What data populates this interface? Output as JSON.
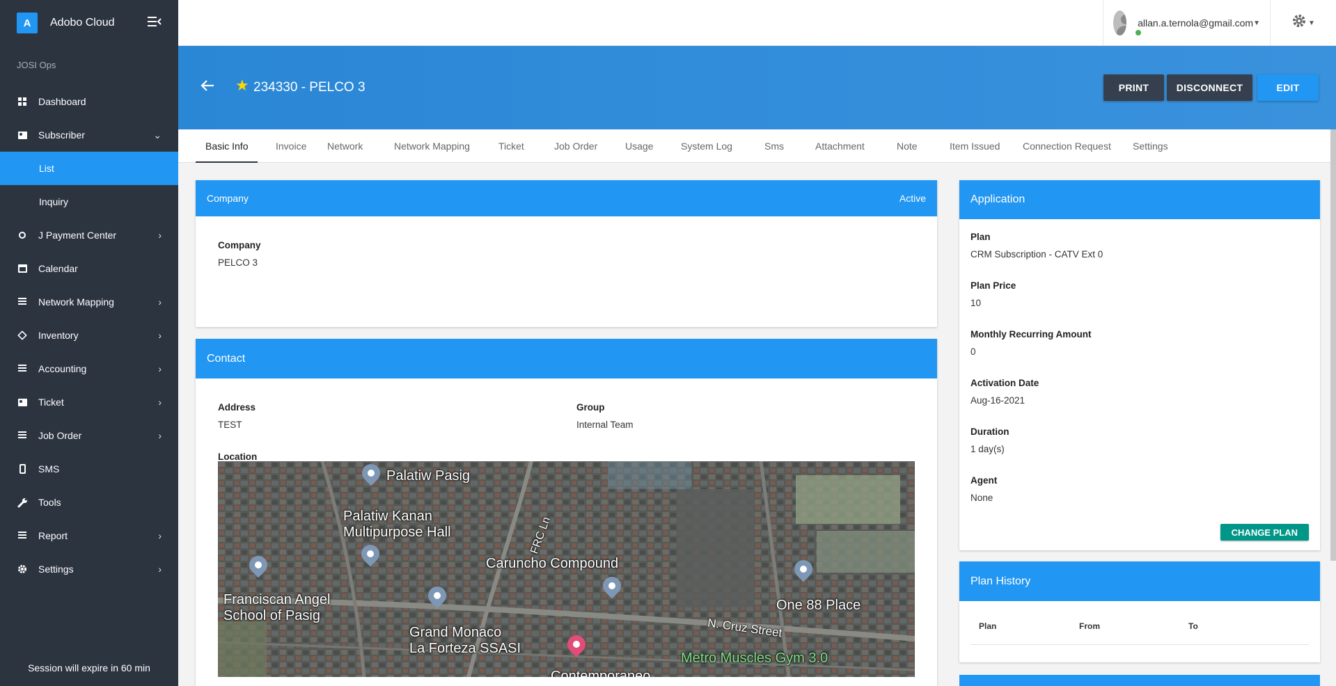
{
  "sidebar": {
    "brand_letter": "A",
    "brand_name": "Adobo Cloud",
    "section": "JOSI Ops",
    "items": {
      "dashboard": "Dashboard",
      "subscriber": "Subscriber",
      "list": "List",
      "inquiry": "Inquiry",
      "payment_center": "J Payment Center",
      "calendar": "Calendar",
      "network_mapping": "Network Mapping",
      "inventory": "Inventory",
      "accounting": "Accounting",
      "ticket": "Ticket",
      "job_order": "Job Order",
      "sms": "SMS",
      "tools": "Tools",
      "report": "Report",
      "settings": "Settings"
    },
    "session_text": "Session will expire in 60 min"
  },
  "topbar": {
    "user_email": "allan.a.ternola@gmail.com"
  },
  "header": {
    "title": "234330 - PELCO 3",
    "print_label": "PRINT",
    "disconnect_label": "DISCONNECT",
    "edit_label": "EDIT"
  },
  "tabs": {
    "basic_info": "Basic Info",
    "invoice": "Invoice",
    "network": "Network",
    "network_mapping": "Network Mapping",
    "ticket": "Ticket",
    "job_order": "Job Order",
    "usage": "Usage",
    "system_log": "System Log",
    "sms": "Sms",
    "attachment": "Attachment",
    "note": "Note",
    "item_issued": "Item Issued",
    "connection_request": "Connection Request",
    "settings": "Settings"
  },
  "company_card": {
    "header": "Company",
    "status": "Active",
    "label": "Company",
    "value": "PELCO 3"
  },
  "contact_card": {
    "header": "Contact",
    "address_label": "Address",
    "address_value": "TEST",
    "group_label": "Group",
    "group_value": "Internal Team",
    "location_label": "Location",
    "map_labels": {
      "palatiw_pasig": "Palatiw Pasig",
      "palatiw_kanan": "Palatiw Kanan\nMultipurpose Hall",
      "frc_ln": "FRC Ln",
      "caruncho": "Caruncho Compound",
      "franciscan": "Franciscan Angel\nSchool of Pasig",
      "grand_monaco": "Grand Monaco\nLa Forteza SSASI",
      "one88": "One 88 Place",
      "cruz_street": "N. Cruz Street",
      "metro_muscles": "Metro Muscles Gym 3.0",
      "contemporaneo": "Contemporaneo"
    }
  },
  "application_card": {
    "header": "Application",
    "fields": {
      "plan_label": "Plan",
      "plan_value": "CRM Subscription - CATV Ext 0",
      "plan_price_label": "Plan Price",
      "plan_price_value": "10",
      "mra_label": "Monthly Recurring Amount",
      "mra_value": "0",
      "activation_label": "Activation Date",
      "activation_value": "Aug-16-2021",
      "duration_label": "Duration",
      "duration_value": "1 day(s)",
      "agent_label": "Agent",
      "agent_value": "None"
    },
    "change_plan_label": "CHANGE PLAN"
  },
  "plan_history_card": {
    "header": "Plan History",
    "columns": [
      "Plan",
      "From",
      "To"
    ]
  },
  "colors": {
    "sidebar_bg": "#2c3440",
    "primary": "#2196f3",
    "dark_button": "#353f4d",
    "teal_button": "#009688"
  }
}
